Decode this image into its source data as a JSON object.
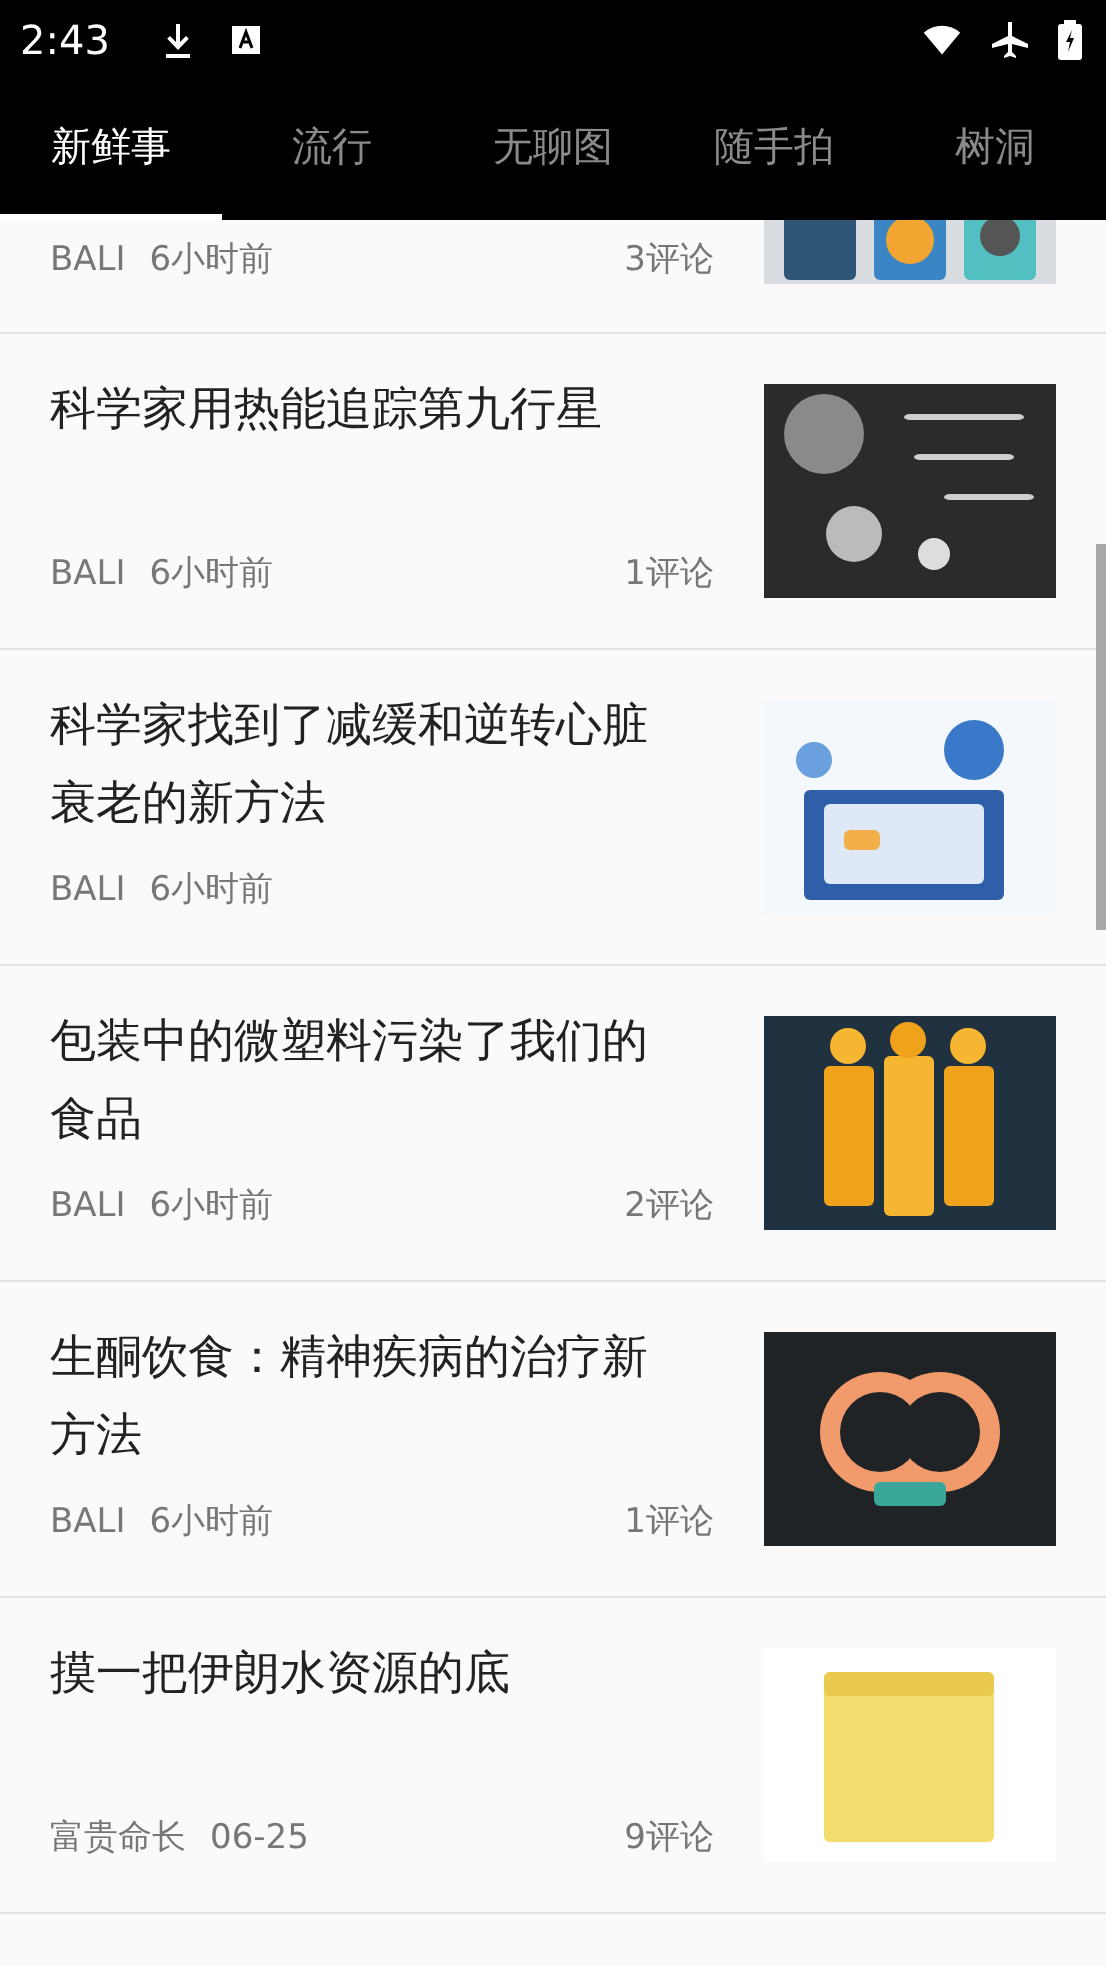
{
  "status_bar": {
    "time": "2:43"
  },
  "tabs": [
    {
      "label": "新鲜事",
      "selected": true
    },
    {
      "label": "流行",
      "selected": false
    },
    {
      "label": "无聊图",
      "selected": false
    },
    {
      "label": "随手拍",
      "selected": false
    },
    {
      "label": "树洞",
      "selected": false
    }
  ],
  "posts": [
    {
      "author": "BALI",
      "time": "6小时前",
      "comments": "3评论",
      "partial": true
    },
    {
      "title": "科学家用热能追踪第九行星",
      "author": "BALI",
      "time": "6小时前",
      "comments": "1评论"
    },
    {
      "title": "科学家找到了减缓和逆转心脏衰老的新方法",
      "author": "BALI",
      "time": "6小时前"
    },
    {
      "title": "包装中的微塑料污染了我们的食品",
      "author": "BALI",
      "time": "6小时前",
      "comments": "2评论"
    },
    {
      "title": "生酮饮食：精神疾病的治疗新方法",
      "author": "BALI",
      "time": "6小时前",
      "comments": "1评论"
    },
    {
      "title": "摸一把伊朗水资源的底",
      "author": "富贵命长",
      "time": "06-25",
      "comments": "9评论"
    }
  ]
}
